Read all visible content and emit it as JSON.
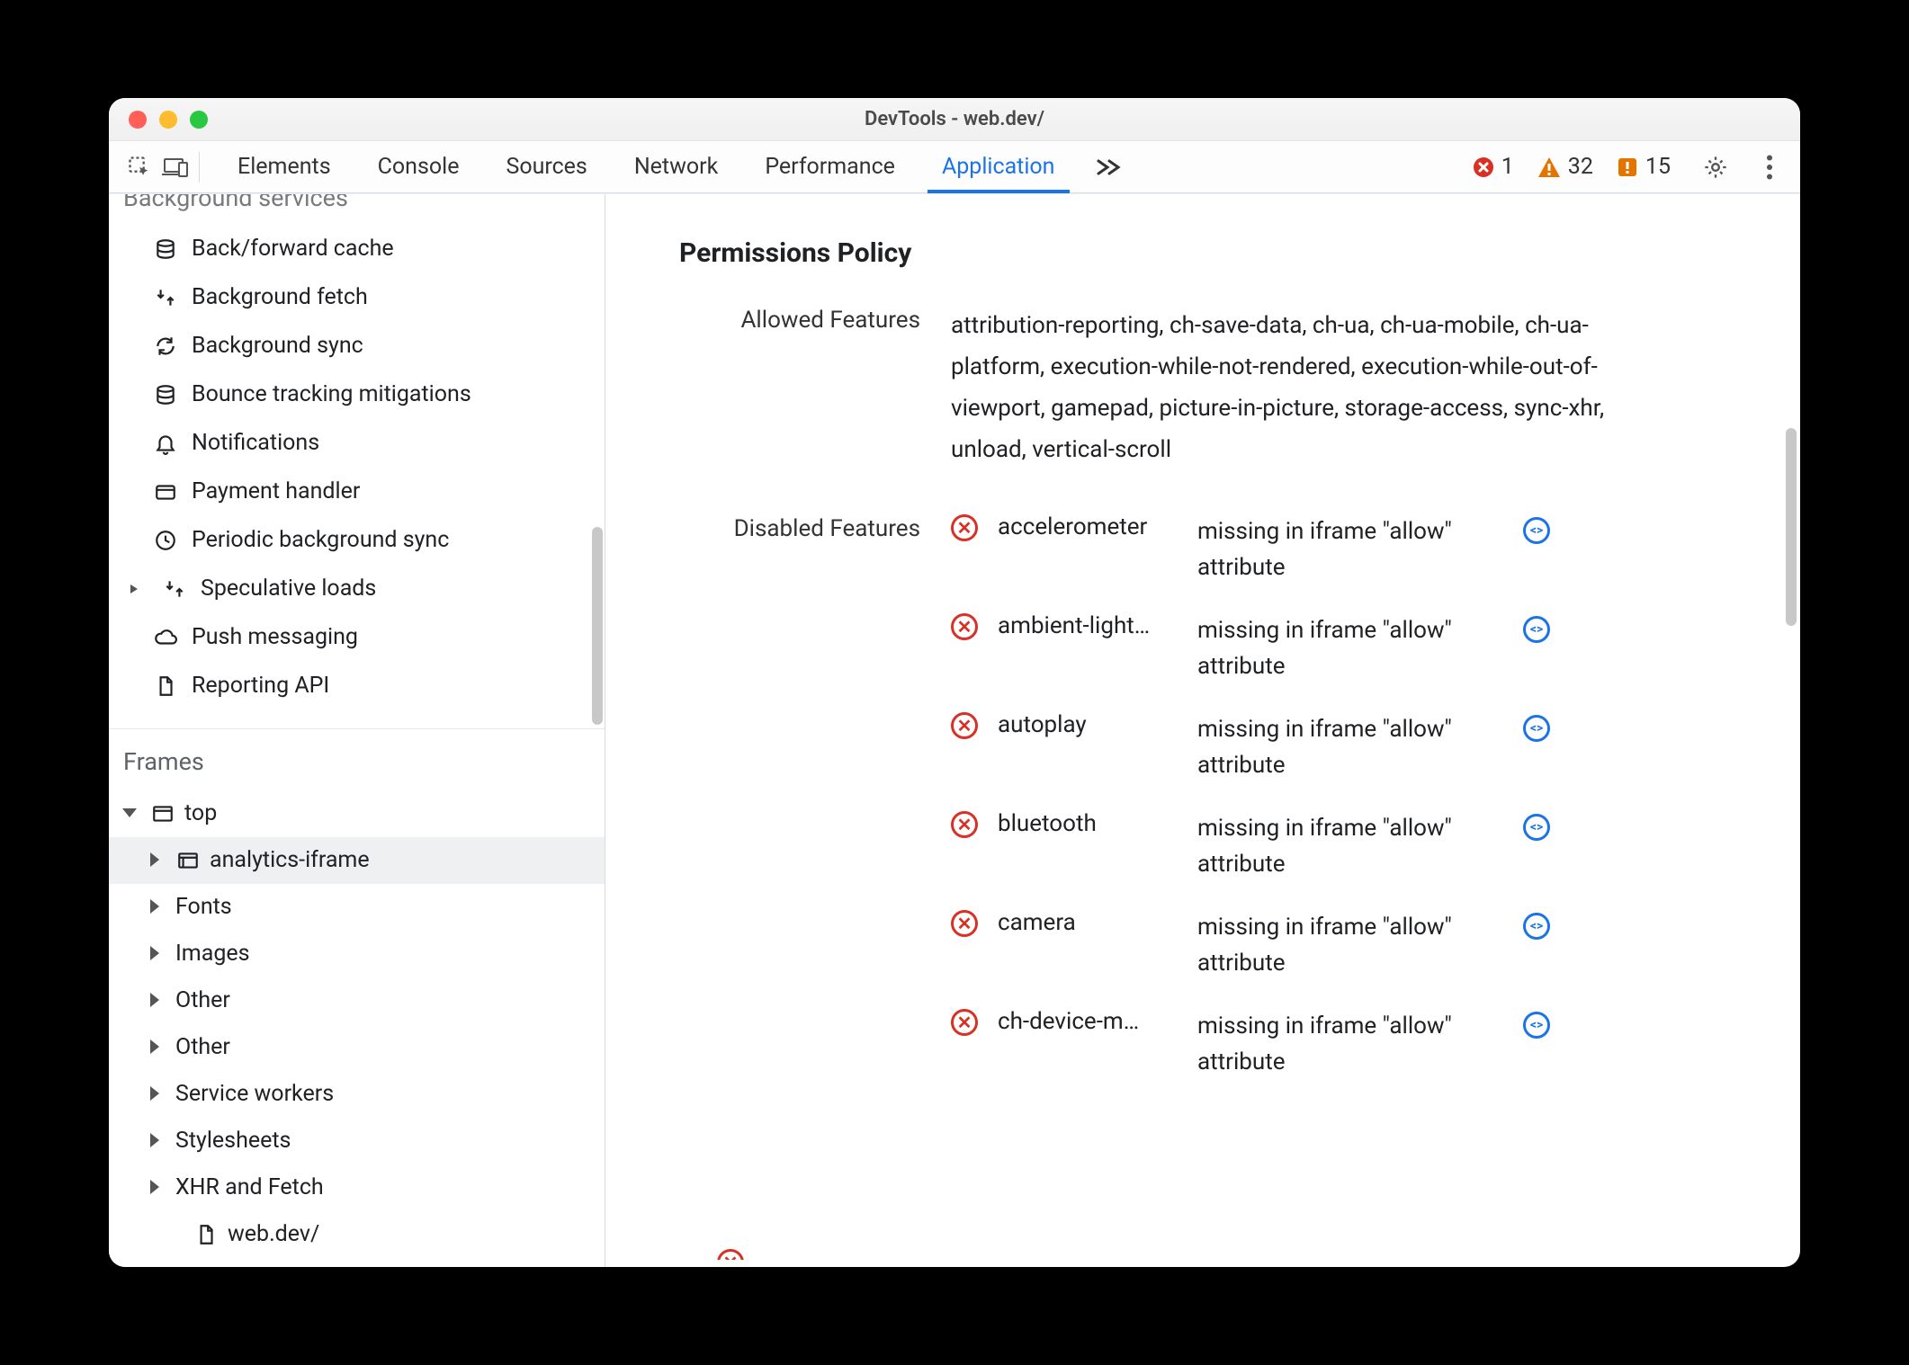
{
  "window_title": "DevTools - web.dev/",
  "toolbar": {
    "tabs": [
      "Elements",
      "Console",
      "Sources",
      "Network",
      "Performance",
      "Application"
    ],
    "active_tab": "Application",
    "counts": {
      "errors": "1",
      "warnings": "32",
      "issues": "15"
    }
  },
  "sidebar": {
    "section_bg_services": {
      "title": "Background services",
      "items": [
        {
          "icon": "db",
          "label": "Back/forward cache"
        },
        {
          "icon": "fetch",
          "label": "Background fetch"
        },
        {
          "icon": "sync",
          "label": "Background sync"
        },
        {
          "icon": "db",
          "label": "Bounce tracking mitigations"
        },
        {
          "icon": "bell",
          "label": "Notifications"
        },
        {
          "icon": "card",
          "label": "Payment handler"
        },
        {
          "icon": "clock",
          "label": "Periodic background sync"
        },
        {
          "icon": "fetch",
          "label": "Speculative loads",
          "expandable": true
        },
        {
          "icon": "cloud",
          "label": "Push messaging"
        },
        {
          "icon": "doc",
          "label": "Reporting API"
        }
      ]
    },
    "frames_title": "Frames",
    "tree": [
      {
        "depth": 0,
        "arrow": "down",
        "icon": "frame",
        "label": "top"
      },
      {
        "depth": 1,
        "arrow": "right",
        "icon": "iframe",
        "label": "analytics-iframe",
        "selected": true
      },
      {
        "depth": 1,
        "arrow": "right",
        "icon": "",
        "label": "Fonts"
      },
      {
        "depth": 1,
        "arrow": "right",
        "icon": "",
        "label": "Images"
      },
      {
        "depth": 1,
        "arrow": "right",
        "icon": "",
        "label": "Other"
      },
      {
        "depth": 1,
        "arrow": "right",
        "icon": "",
        "label": "Other"
      },
      {
        "depth": 1,
        "arrow": "right",
        "icon": "",
        "label": "Service workers"
      },
      {
        "depth": 1,
        "arrow": "right",
        "icon": "",
        "label": "Stylesheets"
      },
      {
        "depth": 1,
        "arrow": "right",
        "icon": "",
        "label": "XHR and Fetch"
      },
      {
        "depth": 2,
        "arrow": "none",
        "icon": "doc",
        "label": "web.dev/"
      }
    ]
  },
  "main": {
    "title": "Permissions Policy",
    "allowed_label": "Allowed Features",
    "allowed_value": "attribution-reporting, ch-save-data, ch-ua, ch-ua-mobile, ch-ua-platform, execution-while-not-rendered, execution-while-out-of-viewport, gamepad, picture-in-picture, storage-access, sync-xhr, unload, vertical-scroll",
    "disabled_label": "Disabled Features",
    "disabled": [
      {
        "feature": "accelerometer",
        "reason": "missing in iframe \"allow\" attribute"
      },
      {
        "feature": "ambient-light…",
        "reason": "missing in iframe \"allow\" attribute"
      },
      {
        "feature": "autoplay",
        "reason": "missing in iframe \"allow\" attribute"
      },
      {
        "feature": "bluetooth",
        "reason": "missing in iframe \"allow\" attribute"
      },
      {
        "feature": "camera",
        "reason": "missing in iframe \"allow\" attribute"
      },
      {
        "feature": "ch-device-m…",
        "reason": "missing in iframe \"allow\" attribute"
      }
    ]
  }
}
